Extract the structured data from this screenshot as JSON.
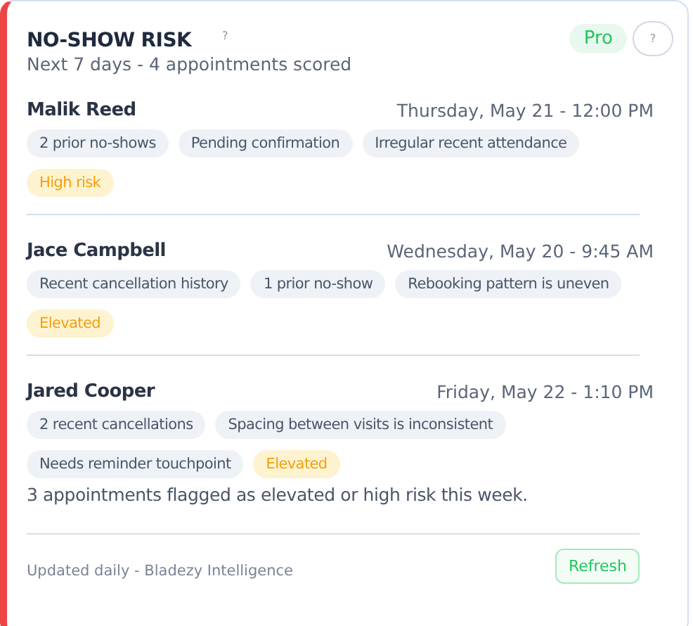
{
  "header": {
    "title": "NO-SHOW RISK",
    "help_mark": "?",
    "plan_badge": "Pro",
    "help_button": "?",
    "subtitle": "Next 7 days - 4 appointments scored"
  },
  "appointments": [
    {
      "name": "Malik Reed",
      "when": "Thursday, May 21 - 12:00 PM",
      "factors": [
        "2 prior no-shows",
        "Pending confirmation",
        "Irregular recent attendance"
      ],
      "risk": "High risk"
    },
    {
      "name": "Jace Campbell",
      "when": "Wednesday, May 20 - 9:45 AM",
      "factors": [
        "Recent cancellation history",
        "1 prior no-show",
        "Rebooking pattern is uneven"
      ],
      "risk": "Elevated"
    },
    {
      "name": "Jared Cooper",
      "when": "Friday, May 22 - 1:10 PM",
      "factors": [
        "2 recent cancellations",
        "Spacing between visits is inconsistent",
        "Needs reminder touchpoint"
      ],
      "risk": "Elevated"
    }
  ],
  "summary": "3 appointments flagged as elevated or high risk this week.",
  "footer": {
    "note": "Updated daily - Bladezy Intelligence",
    "button": "Refresh"
  }
}
